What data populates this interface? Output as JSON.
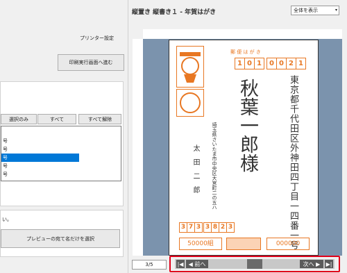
{
  "left": {
    "printer_settings": "プリンター設定",
    "print_screen_button": "印刷実行画面へ進む",
    "select_only": "選択のみ",
    "all": "すべて",
    "clear_all": "すべて解除",
    "list_items": [
      "号",
      "号",
      "号",
      "号",
      "号"
    ],
    "selected_index": 2,
    "notice": "い。",
    "preview_select_button": "プレビューの宛て名だけを選択"
  },
  "right": {
    "title": "縦置き 縦書き１ - 年賀はがき",
    "zoom_select": "全体を表示",
    "page_counter": "3/5",
    "prev_button": "◀ 前へ",
    "next_button": "次へ ▶",
    "first_icon": "|◀",
    "last_icon": "▶|"
  },
  "card": {
    "header": "郵 便 は が き",
    "postal_code": [
      "1",
      "0",
      "1",
      "0",
      "0",
      "2",
      "1"
    ],
    "to_address": "東京都千代田区外神田四丁目一四番一号",
    "to_name": [
      "秋",
      "葉",
      "一",
      "郎",
      "様"
    ],
    "from_address": "埼玉県さいたま市中央区大宮町二の五ハ",
    "from_name": "太田二郎",
    "from_postal": [
      "3",
      "7",
      "3",
      "3",
      "8",
      "2",
      "3"
    ],
    "stamp_text_left": "50000組",
    "stamp_text_right": "000000"
  },
  "colors": {
    "accent": "#e87722",
    "canvas": "#7b93ad",
    "highlight": "#e0001a",
    "selection": "#0078d7"
  }
}
